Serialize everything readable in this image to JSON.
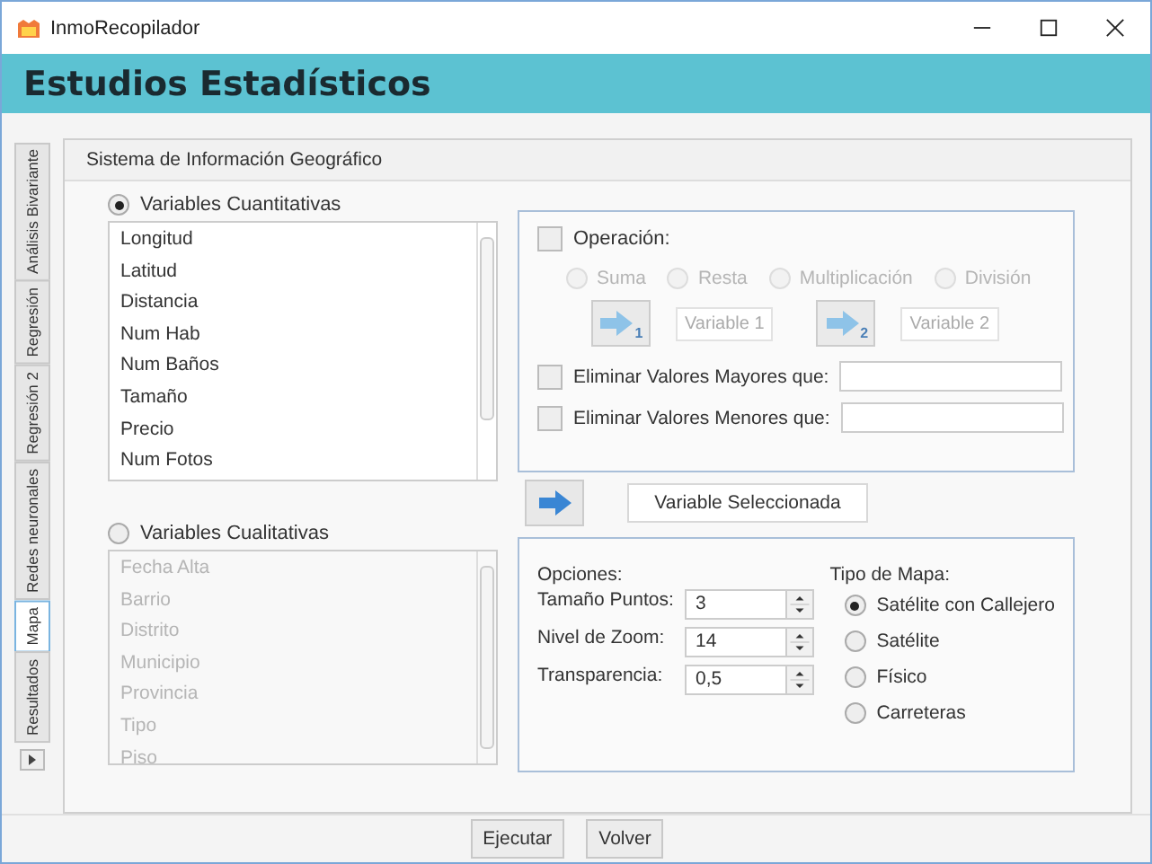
{
  "window": {
    "title": "InmoRecopilador"
  },
  "header": {
    "title": "Estudios Estadísticos"
  },
  "side_tabs": [
    {
      "label": "Análisis Bivariante",
      "selected": false
    },
    {
      "label": "Regresión",
      "selected": false
    },
    {
      "label": "Regresión 2",
      "selected": false
    },
    {
      "label": "Redes neuronales",
      "selected": false
    },
    {
      "label": "Mapa",
      "selected": true
    },
    {
      "label": "Resultados",
      "selected": false
    }
  ],
  "panel": {
    "title": "Sistema de Información Geográfico",
    "variable_groups": [
      {
        "label": "Variables Cuantitativas",
        "selected": true,
        "disabled": false,
        "items": [
          "Longitud",
          "Latitud",
          "Distancia",
          "Num Hab",
          "Num Baños",
          "Tamaño",
          "Precio",
          "Num Fotos"
        ]
      },
      {
        "label": "Variables Cualitativas",
        "selected": false,
        "disabled": true,
        "items": [
          "Fecha Alta",
          "Barrio",
          "Distrito",
          "Municipio",
          "Provincia",
          "Tipo",
          "Piso"
        ]
      }
    ],
    "operation": {
      "label": "Operación:",
      "checked": false,
      "disabled": true,
      "operators": [
        {
          "label": "Suma",
          "selected": false
        },
        {
          "label": "Resta",
          "selected": false
        },
        {
          "label": "Multiplicación",
          "selected": false
        },
        {
          "label": "División",
          "selected": false
        }
      ],
      "operands": [
        {
          "number": "1",
          "value": "Variable 1"
        },
        {
          "number": "2",
          "value": "Variable 2"
        }
      ]
    },
    "filters": [
      {
        "label": "Eliminar Valores Mayores que:",
        "checked": false
      },
      {
        "label": "Eliminar Valores Menores que:",
        "checked": false
      }
    ],
    "selected_variable": "Variable Seleccionada",
    "options": {
      "title": "Opciones:",
      "spinners": [
        {
          "label": "Tamaño Puntos:",
          "value": "3"
        },
        {
          "label": "Nivel de Zoom:",
          "value": "14"
        },
        {
          "label": "Transparencia:",
          "value": "0,5"
        }
      ]
    },
    "map_type": {
      "title": "Tipo de Mapa:",
      "options": [
        {
          "label": "Satélite con Callejero",
          "selected": true
        },
        {
          "label": "Satélite",
          "selected": false
        },
        {
          "label": "Físico",
          "selected": false
        },
        {
          "label": "Carreteras",
          "selected": false
        }
      ]
    }
  },
  "buttons": [
    "Ejecutar",
    "Volver"
  ]
}
